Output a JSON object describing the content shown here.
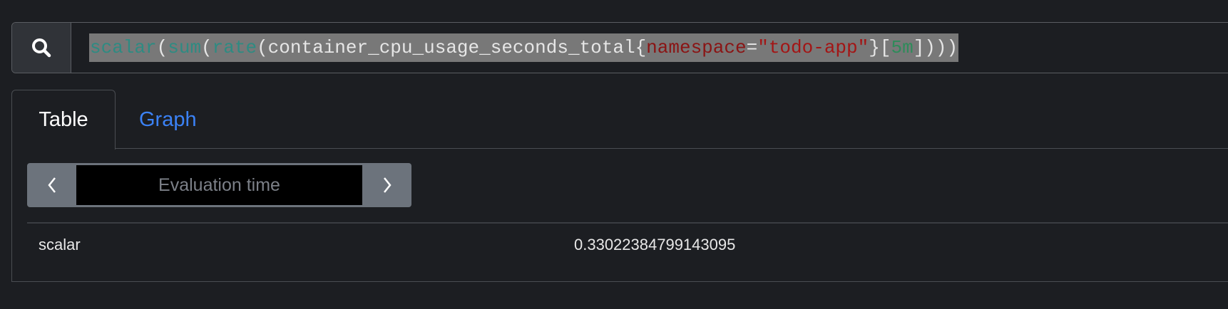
{
  "query": {
    "tokens": [
      {
        "text": "scalar",
        "kind": "fn"
      },
      {
        "text": "(",
        "kind": "plain"
      },
      {
        "text": "sum",
        "kind": "fn"
      },
      {
        "text": "(",
        "kind": "plain"
      },
      {
        "text": "rate",
        "kind": "fn"
      },
      {
        "text": "(container_cpu_usage_seconds_total{",
        "kind": "plain"
      },
      {
        "text": "namespace",
        "kind": "lbl"
      },
      {
        "text": "=",
        "kind": "plain"
      },
      {
        "text": "\"todo-app\"",
        "kind": "str"
      },
      {
        "text": "}[",
        "kind": "plain"
      },
      {
        "text": "5m",
        "kind": "num"
      },
      {
        "text": "])))",
        "kind": "plain"
      }
    ]
  },
  "tabs": {
    "table": "Table",
    "graph": "Graph"
  },
  "eval": {
    "placeholder": "Evaluation time"
  },
  "result": {
    "label": "scalar",
    "value": "0.33022384799143095"
  }
}
